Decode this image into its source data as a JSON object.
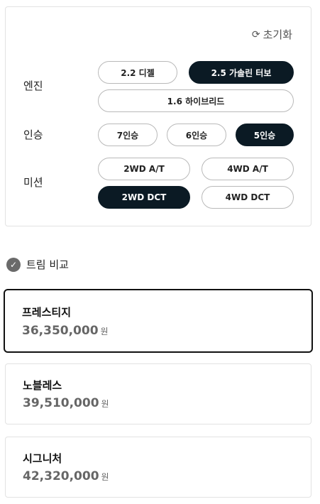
{
  "reset": {
    "label": "초기화",
    "icon": "refresh-icon"
  },
  "engine": {
    "label": "엔진",
    "options": [
      {
        "label": "2.2 디젤",
        "active": false
      },
      {
        "label": "2.5 가솔린 터보",
        "active": true
      },
      {
        "label": "1.6 하이브리드",
        "active": false
      }
    ]
  },
  "seats": {
    "label": "인승",
    "options": [
      {
        "label": "7인승",
        "active": false
      },
      {
        "label": "6인승",
        "active": false
      },
      {
        "label": "5인승",
        "active": true
      }
    ]
  },
  "mission": {
    "label": "미션",
    "options": [
      {
        "label": "2WD A/T",
        "active": false
      },
      {
        "label": "4WD A/T",
        "active": false
      },
      {
        "label": "2WD DCT",
        "active": true
      },
      {
        "label": "4WD DCT",
        "active": false
      }
    ]
  },
  "compare": {
    "label": "트림 비교",
    "icon": "check-circle-icon"
  },
  "trims": [
    {
      "name": "프레스티지",
      "price": "36,350,000",
      "unit": "원",
      "selected": true
    },
    {
      "name": "노블레스",
      "price": "39,510,000",
      "unit": "원",
      "selected": false
    },
    {
      "name": "시그니처",
      "price": "42,320,000",
      "unit": "원",
      "selected": false
    }
  ],
  "colors": {
    "active": "#0b1a24",
    "border": "#e2e2e2",
    "price": "#666666"
  }
}
